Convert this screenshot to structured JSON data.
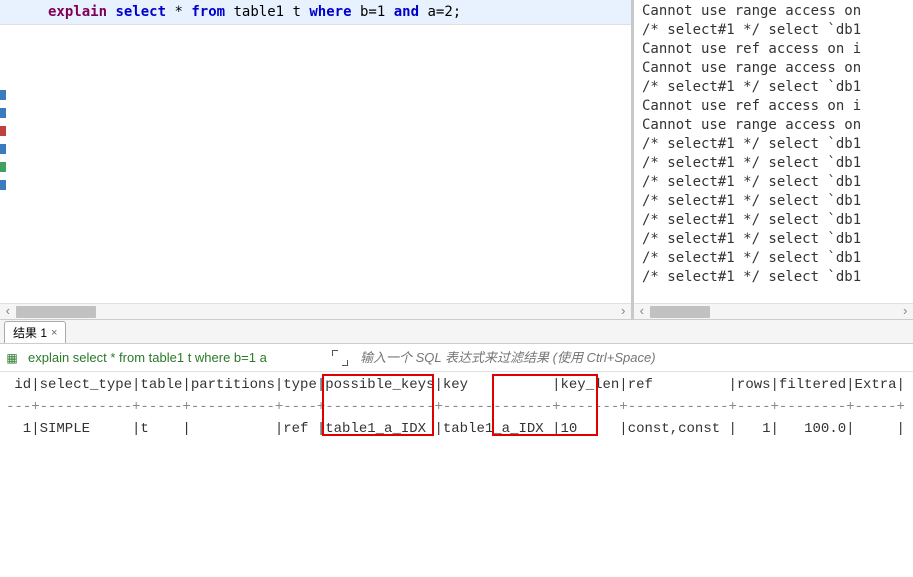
{
  "editor": {
    "kw_explain": "explain",
    "kw_select": "select",
    "star": "*",
    "kw_from": "from",
    "table_tok": "table1 t",
    "kw_where": "where",
    "cond1_l": "b",
    "eq": "=",
    "cond1_r": "1",
    "kw_and": "and",
    "cond2_l": "a",
    "cond2_r": "2",
    "semicolon": ";"
  },
  "log": {
    "lines": [
      "Cannot use range access on",
      "/* select#1 */ select `db1",
      "Cannot use ref access on i",
      "Cannot use range access on",
      "/* select#1 */ select `db1",
      "Cannot use ref access on i",
      "Cannot use range access on",
      "/* select#1 */ select `db1",
      "/* select#1 */ select `db1",
      "/* select#1 */ select `db1",
      "/* select#1 */ select `db1",
      "/* select#1 */ select `db1",
      "/* select#1 */ select `db1",
      "/* select#1 */ select `db1",
      "/* select#1 */ select `db1"
    ]
  },
  "results": {
    "tab_label": "结果 1",
    "sql_echo": "explain select * from table1 t where b=1 a",
    "filter_placeholder": "输入一个 SQL 表达式来过滤结果 (使用 Ctrl+Space)",
    "header": " id|select_type|table|partitions|type|possible_keys|key          |key_len|ref         |rows|filtered|Extra|",
    "row": "  1|SIMPLE     |t    |          |ref |table1_a_IDX |table1_a_IDX |10     |const,const |   1|   100.0|     |",
    "chart_data": {
      "type": "table",
      "columns": [
        "id",
        "select_type",
        "table",
        "partitions",
        "type",
        "possible_keys",
        "key",
        "key_len",
        "ref",
        "rows",
        "filtered",
        "Extra"
      ],
      "rows": [
        {
          "id": 1,
          "select_type": "SIMPLE",
          "table": "t",
          "partitions": "",
          "type": "ref",
          "possible_keys": "table1_a_IDX",
          "key": "table1_a_IDX",
          "key_len": 10,
          "ref": "const,const",
          "rows": 1,
          "filtered": 100.0,
          "Extra": ""
        }
      ],
      "highlighted_columns": [
        "key",
        "ref"
      ]
    }
  }
}
